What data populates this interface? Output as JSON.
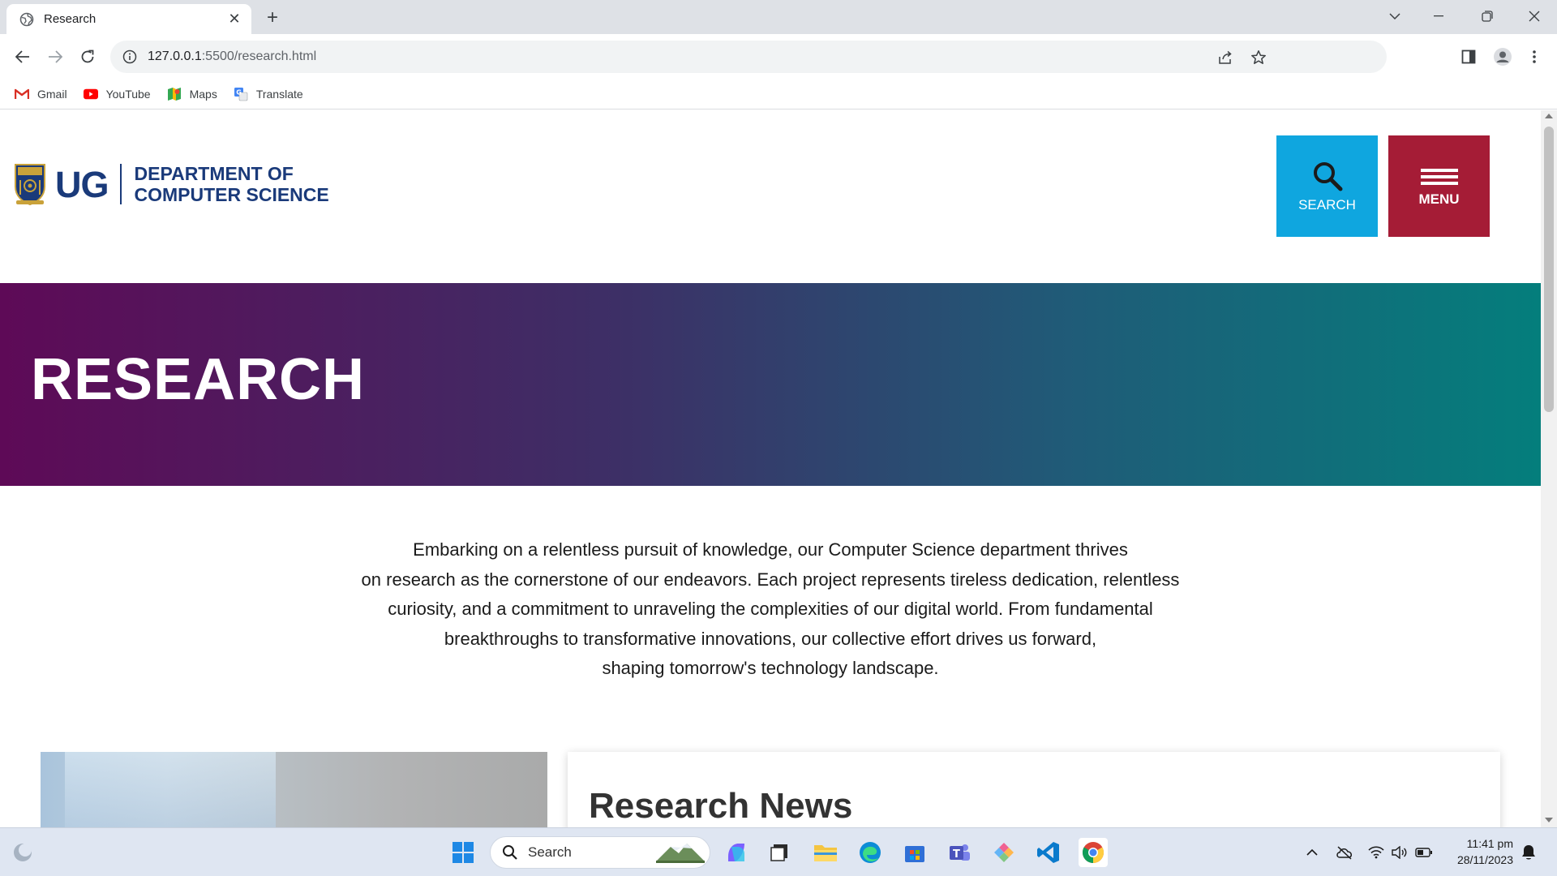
{
  "browser": {
    "tab_title": "Research",
    "url_host": "127.0.0.1",
    "url_rest": ":5500/research.html",
    "bookmarks": [
      "Gmail",
      "YouTube",
      "Maps",
      "Translate"
    ]
  },
  "site": {
    "logo_short": "UG",
    "dept_line1": "DEPARTMENT OF",
    "dept_line2": "COMPUTER SCIENCE",
    "search_label": "SEARCH",
    "menu_label": "MENU",
    "hero_title": "RESEARCH",
    "intro_lines": [
      "Embarking on a relentless pursuit of knowledge, our Computer Science department thrives",
      "on research as the cornerstone of our endeavors. Each project represents tireless dedication, relentless",
      "curiosity, and a commitment to unraveling the complexities of our digital world. From fundamental",
      "breakthroughs to transformative innovations, our collective effort drives us forward,",
      "shaping tomorrow's technology landscape."
    ],
    "news_title": "Research News"
  },
  "taskbar": {
    "search_label": "Search",
    "time": "11:41 pm",
    "date": "28/11/2023"
  },
  "colors": {
    "brand_navy": "#1a3a7a",
    "search_blue": "#0fa6df",
    "menu_red": "#a51c36",
    "hero_start": "#5e0a57",
    "hero_end": "#047e7c"
  }
}
